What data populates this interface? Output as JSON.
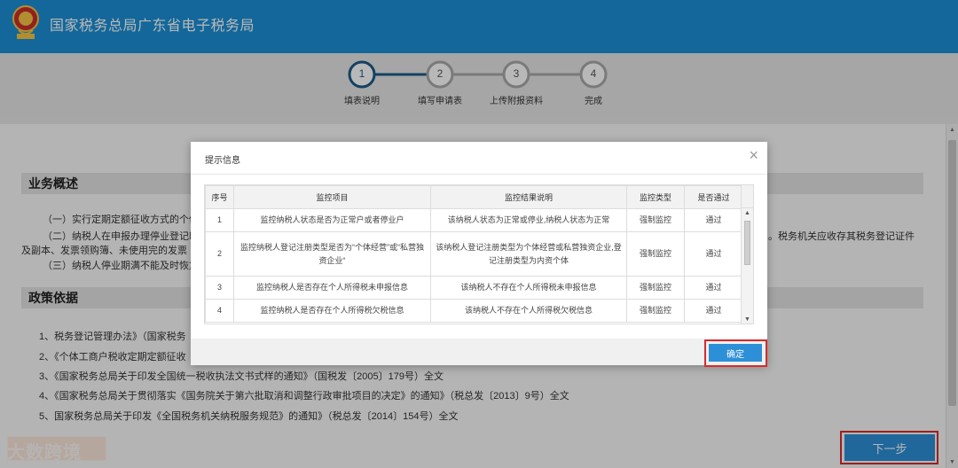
{
  "header": {
    "title": "国家税务总局广东省电子税务局",
    "brand_color": "#1b8fd6"
  },
  "steps": [
    {
      "num": "1",
      "label": "填表说明",
      "active": true
    },
    {
      "num": "2",
      "label": "填写申请表",
      "active": false
    },
    {
      "num": "3",
      "label": "上传附报资料",
      "active": false
    },
    {
      "num": "4",
      "label": "完成",
      "active": false
    }
  ],
  "overview": {
    "heading": "业务概述",
    "p1": "（一）实行定期定额征收方式的个体",
    "p2": "（二）纳税人在申报办理停业登记时",
    "p2_tail": "。税务机关应收存其税务登记证件",
    "p2_cont": "及副本、发票领购簿、未使用完的发票",
    "p3": "（三）纳税人停业期满不能及时恢复"
  },
  "policy": {
    "heading": "政策依据",
    "items": [
      "1、税务登记管理办法》（国家税务",
      "2、《个体工商户税收定期定额征收",
      "3、《国家税务总局关于印发全国统一税收执法文书式样的通知》（国税发〔2005〕179号）全文",
      "4、《国家税务总局关于贯彻落实《国务院关于第六批取消和调整行政审批项目的决定》的通知》（税总发〔2013〕9号）全文",
      "5、国家税务总局关于印发《全国税务机关纳税服务规范》的通知》（税总发〔2014〕154号）全文"
    ]
  },
  "modal": {
    "title": "提示信息",
    "close": "×",
    "columns": [
      "序号",
      "监控项目",
      "监控结果说明",
      "监控类型",
      "是否通过"
    ],
    "rows": [
      [
        "1",
        "监控纳税人状态是否为正常户或者停业户",
        "该纳税人状态为正常或停业,纳税人状态为正常",
        "强制监控",
        "通过"
      ],
      [
        "2",
        "监控纳税人登记注册类型是否为“个体经营”或“私营独资企业“",
        "该纳税人登记注册类型为个体经营或私营独资企业,登记注册类型为内资个体",
        "强制监控",
        "通过"
      ],
      [
        "3",
        "监控纳税人是否存在个人所得税未申报信息",
        "该纳税人不存在个人所得税未申报信息",
        "强制监控",
        "通过"
      ],
      [
        "4",
        "监控纳税人是否存在个人所得税欠税信息",
        "该纳税人不存在个人所得税欠税信息",
        "强制监控",
        "通过"
      ]
    ],
    "confirm": "确定"
  },
  "next_button": "下一步",
  "watermark": "大数跨境",
  "icons": {
    "emblem": "tax-emblem-icon",
    "close": "close-icon",
    "scroll_up": "arrow-up-icon",
    "scroll_down": "arrow-down-icon"
  }
}
